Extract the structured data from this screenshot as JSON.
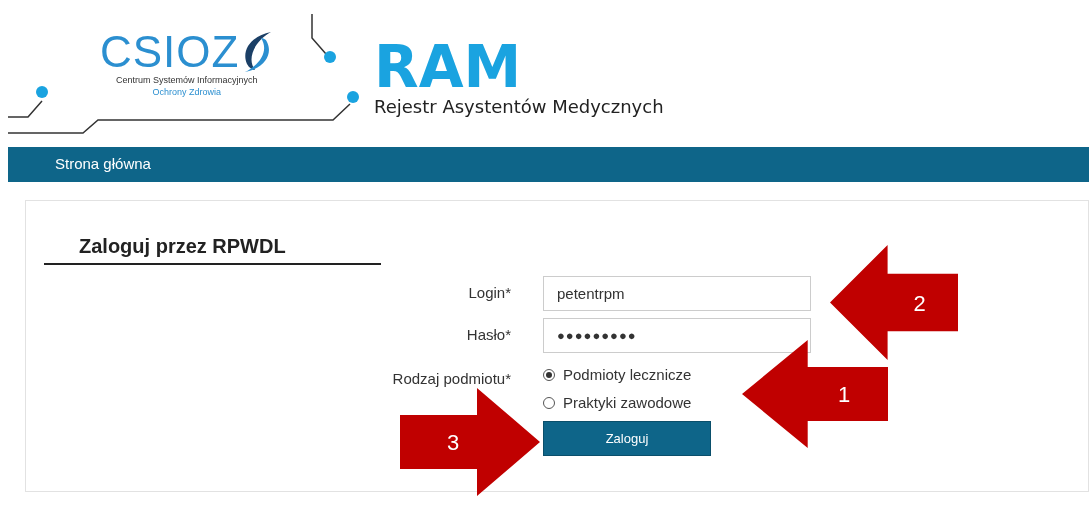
{
  "logo": {
    "wordmark": "CSIOZ",
    "line_1": "Centrum Systemów Informacyjnych",
    "line_2": "Ochrony Zdrowia"
  },
  "app": {
    "name": "RAM",
    "subtitle": "Rejestr Asystentów Medycznych"
  },
  "nav": [
    {
      "label": "Strona główna"
    }
  ],
  "login": {
    "title": "Zaloguj przez RPWDL",
    "fields": [
      {
        "label": "Login*",
        "value": "petentrpm",
        "kind": "text"
      },
      {
        "label": "Hasło*",
        "value": "●●●●●●●●●",
        "kind": "password"
      }
    ],
    "entity_label": "Rodzaj podmiotu*",
    "options": [
      {
        "label": "Podmioty lecznicze",
        "selected": true
      },
      {
        "label": "Praktyki zawodowe",
        "selected": false
      }
    ],
    "submit": "Zaloguj"
  },
  "annotations": [
    {
      "number": "2",
      "kind": "left"
    },
    {
      "number": "1",
      "kind": "left"
    },
    {
      "number": "3",
      "kind": "right"
    }
  ]
}
